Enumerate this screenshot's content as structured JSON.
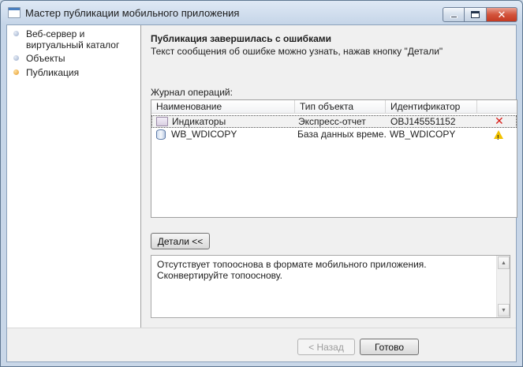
{
  "window": {
    "title": "Мастер публикации мобильного приложения",
    "controls": {
      "minimize_icon": "minimize-icon",
      "maximize_icon": "maximize-icon",
      "close_icon": "close-icon",
      "close_glyph": "✕"
    }
  },
  "sidebar": {
    "steps": [
      {
        "label": "Веб-сервер и виртуальный каталог",
        "state": "done"
      },
      {
        "label": "Объекты",
        "state": "done"
      },
      {
        "label": "Публикация",
        "state": "current"
      }
    ]
  },
  "main": {
    "title": "Публикация завершилась с ошибками",
    "subtitle": "Текст сообщения об ошибке можно узнать, нажав кнопку \"Детали\"",
    "log_label": "Журнал операций:",
    "log": {
      "columns": [
        "Наименование",
        "Тип объекта",
        "Идентификатор"
      ],
      "rows": [
        {
          "name": "Индикаторы",
          "type": "Экспресс-отчет",
          "id": "OBJ145551152",
          "status": "error",
          "icon": "cube-icon",
          "status_glyph": "✕"
        },
        {
          "name": "WB_WDICOPY",
          "type": "База данных време...",
          "id": "WB_WDICOPY",
          "status": "warning",
          "icon": "database-icon",
          "status_glyph": "!"
        }
      ]
    },
    "details_button": "Детали <<",
    "details_text": "Отсутствует топооснова в формате мобильного приложения. Сконвертируйте топооснову."
  },
  "footer": {
    "back_button": "< Назад",
    "finish_button": "Готово"
  },
  "colors": {
    "accent_dot": "#e49a2a",
    "error": "#d9201b",
    "warning": "#f2c200"
  }
}
